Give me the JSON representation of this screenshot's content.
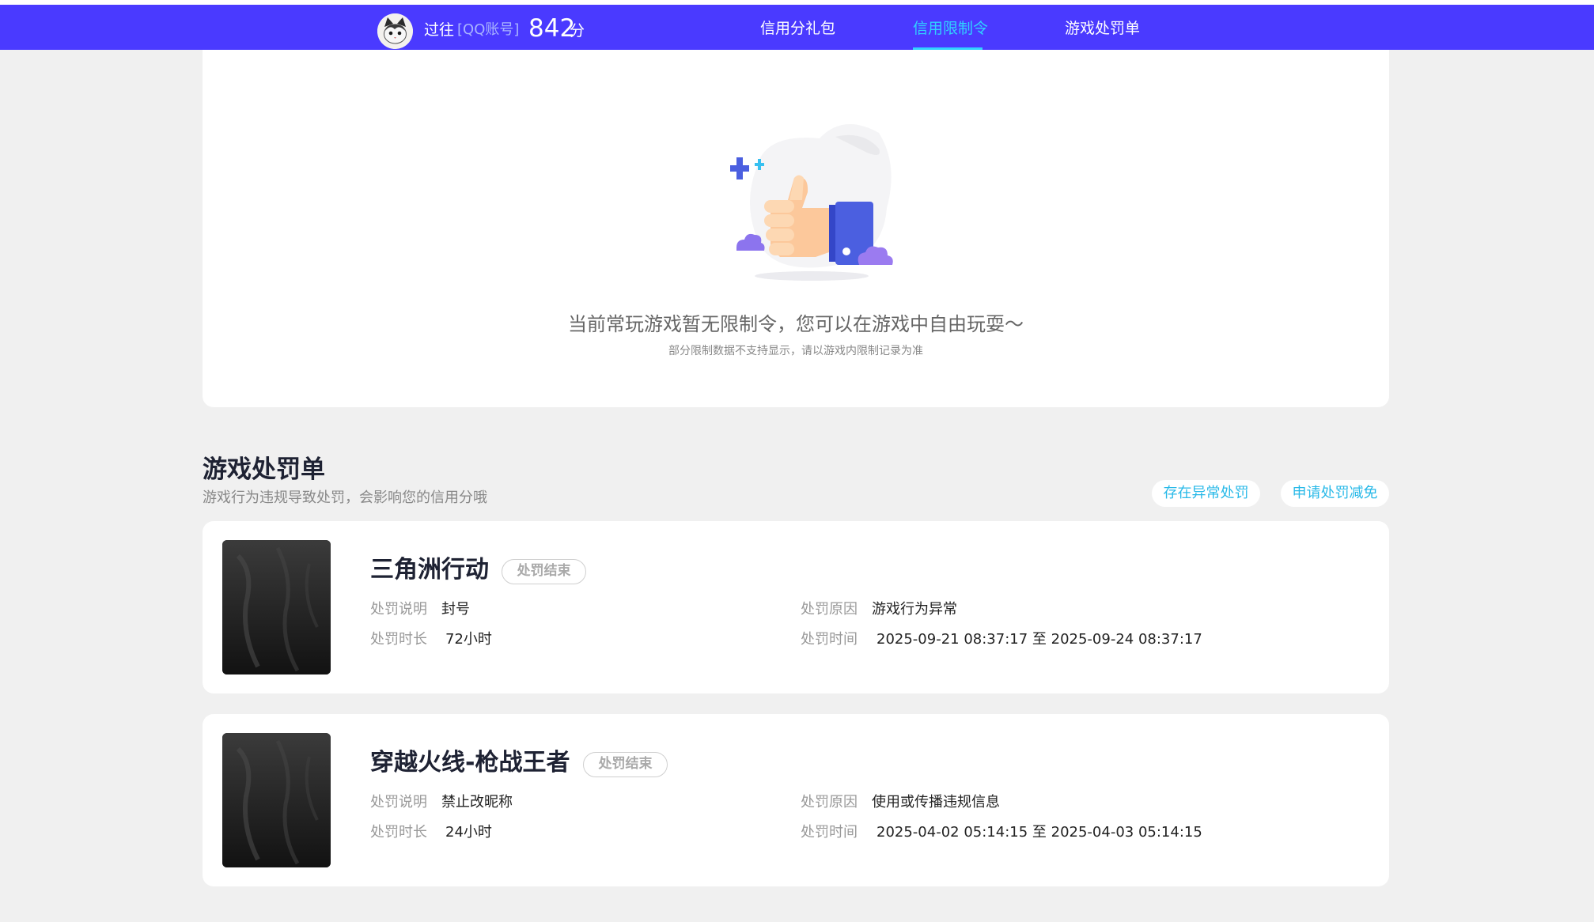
{
  "header": {
    "user_name": "过往",
    "account_type": "[QQ账号]",
    "score": "842",
    "score_unit": "分",
    "tabs": [
      {
        "label": "信用分礼包"
      },
      {
        "label": "信用限制令"
      },
      {
        "label": "游戏处罚单"
      }
    ],
    "active_tab": "信用限制令"
  },
  "restriction": {
    "empty_title": "当前常玩游戏暂无限制令，您可以在游戏中自由玩耍～",
    "empty_sub": "部分限制数据不支持显示，请以游戏内限制记录为准"
  },
  "penalty_section": {
    "title": "游戏处罚单",
    "subtitle": "游戏行为违规导致处罚，会影响您的信用分哦",
    "btn_abnormal": "存在异常处罚",
    "btn_reduce": "申请处罚减免",
    "labels": {
      "desc": "处罚说明",
      "duration": "处罚时长",
      "reason": "处罚原因",
      "time": "处罚时间"
    },
    "items": [
      {
        "game": "三角洲行动",
        "status": "处罚结束",
        "desc": "封号",
        "duration": "72小时",
        "reason": "游戏行为异常",
        "time": "2025-09-21 08:37:17 至 2025-09-24 08:37:17"
      },
      {
        "game": "穿越火线-枪战王者",
        "status": "处罚结束",
        "desc": "禁止改昵称",
        "duration": "24小时",
        "reason": "使用或传播违规信息",
        "time": "2025-04-02 05:14:15 至 2025-04-03 05:14:15"
      }
    ]
  },
  "colors": {
    "nav_bg": "#4a3aff",
    "accent": "#30d3ff",
    "link": "#28b9e8",
    "page_bg": "#f0f0f0"
  }
}
